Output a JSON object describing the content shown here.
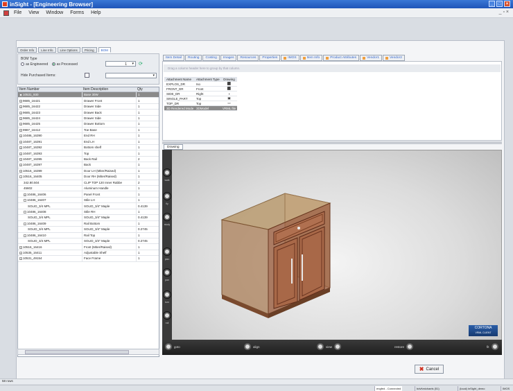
{
  "window": {
    "title": "inSight - [Engineering Browser]"
  },
  "menu": [
    "File",
    "View",
    "Window",
    "Forms",
    "Help"
  ],
  "orderTabs": [
    "Order Info",
    "Line Info",
    "Line Options",
    "Pricing",
    "BOM"
  ],
  "bom": {
    "type_label": "BOM Type",
    "opt_engineered": "as Engineered",
    "opt_processed": "as Processed",
    "hide_purchased_label": "Hide Purchased Items:",
    "qty_value": "1"
  },
  "grid": {
    "headers": [
      "Item Number",
      "Item Description",
      "Qty"
    ],
    "rows": [
      {
        "n": "10531_930",
        "d": "Base 30W",
        "q": "1",
        "sel": true,
        "exp": "-"
      },
      {
        "n": "9685_16421",
        "d": "Drawer Front",
        "q": "1",
        "exp": "+"
      },
      {
        "n": "9685_16422",
        "d": "Drawer Side",
        "q": "1",
        "exp": "+"
      },
      {
        "n": "9685_16423",
        "d": "Drawer Back",
        "q": "1",
        "exp": "+"
      },
      {
        "n": "9685_16424",
        "d": "Drawer Side",
        "q": "1",
        "exp": "+"
      },
      {
        "n": "9685_16425",
        "d": "Drawer Bottom",
        "q": "1",
        "exp": "+"
      },
      {
        "n": "9987_16412",
        "d": "Toe Base",
        "q": "1",
        "exp": "+"
      },
      {
        "n": "10486_16390",
        "d": "End RH",
        "q": "1",
        "exp": "+"
      },
      {
        "n": "10487_16391",
        "d": "End LH",
        "q": "1",
        "exp": "+"
      },
      {
        "n": "10487_16392",
        "d": "Bottom shelf",
        "q": "1",
        "exp": "+"
      },
      {
        "n": "10487_16393",
        "d": "Top",
        "q": "1",
        "exp": "+"
      },
      {
        "n": "10487_16395",
        "d": "Back Rail",
        "q": "2",
        "exp": "+"
      },
      {
        "n": "10487_16397",
        "d": "Back",
        "q": "1",
        "exp": "+"
      },
      {
        "n": "10516_16399",
        "d": "Door LH (Miter/Raised)",
        "q": "1",
        "exp": "+"
      },
      {
        "n": "10516_16405",
        "d": "Door RH (Miter/Raised)",
        "q": "1",
        "exp": "-"
      },
      {
        "n": "342.80.504",
        "d": "CLIP TOP 120 Inner Rabbe",
        "q": "2",
        "ind": 1
      },
      {
        "n": "45602",
        "d": "Aluminum Handle",
        "q": "1",
        "ind": 1
      },
      {
        "n": "10486_16406",
        "d": "Panel Front",
        "q": "1",
        "exp": "+",
        "ind": 1
      },
      {
        "n": "10486_16407",
        "d": "Stile LH",
        "q": "1",
        "exp": "-",
        "ind": 1
      },
      {
        "n": "SOLID_3/4 MPL",
        "d": "SOLID_3/4\" Maple",
        "q": "0.4139",
        "ind": 2
      },
      {
        "n": "10486_16408",
        "d": "Stile RH",
        "q": "1",
        "exp": "-",
        "ind": 1
      },
      {
        "n": "SOLID_3/4 MPL",
        "d": "SOLID_3/4\" Maple",
        "q": "0.4139",
        "ind": 2
      },
      {
        "n": "10486_16409",
        "d": "Rail Bottom",
        "q": "1",
        "exp": "-",
        "ind": 1
      },
      {
        "n": "SOLID_3/4 MPL",
        "d": "SOLID_3/4\" Maple",
        "q": "0.2745",
        "ind": 2
      },
      {
        "n": "10486_16410",
        "d": "Rail Top",
        "q": "1",
        "exp": "-",
        "ind": 1
      },
      {
        "n": "SOLID_3/4 MPL",
        "d": "SOLID_3/4\" Maple",
        "q": "0.2745",
        "ind": 2
      },
      {
        "n": "10516_16416",
        "d": "Front (Miter/Raised)",
        "q": "1",
        "exp": "+"
      },
      {
        "n": "10535_16411",
        "d": "Adjustable Shelf",
        "q": "1",
        "exp": "+"
      },
      {
        "n": "10531_49154",
        "d": "Face Frame",
        "q": "1",
        "exp": "+"
      }
    ]
  },
  "rightTabs": [
    "Item Detail",
    "Routing",
    "Costing",
    "Images",
    "Resources",
    "Properties",
    "IMOS",
    "Item Info",
    "Product Attributes",
    "Vendor1",
    "Vendor2"
  ],
  "groupbar": "Drag a column header here to group by that column.",
  "attachments": {
    "headers": [
      "Attachment Name",
      "Attachment Type",
      "Drawing"
    ],
    "rows": [
      {
        "name": "EXPLOS_DR",
        "type": "Iso"
      },
      {
        "name": "FRONT_DR",
        "type": "Front"
      },
      {
        "name": "SIDE_DR",
        "type": "Right"
      },
      {
        "name": "SINGLE_PART",
        "type": "Top"
      },
      {
        "name": "TOP_DR",
        "type": "Top"
      },
      {
        "name": "3D Rendered Mode",
        "type": "3DModel",
        "draw": "VRML file",
        "sel": true
      }
    ]
  },
  "drawingTab": "Drawing",
  "viewer": {
    "side": [
      "walk",
      "fly",
      "study",
      "plan",
      "pan",
      "turn",
      "roll"
    ],
    "bottom": {
      "goto": "goto",
      "align": "align",
      "view": "view",
      "restore": "restore",
      "fit": "fit"
    },
    "brand_top": "CORTONA",
    "brand_sub": "VRML CLIENT"
  },
  "cancel": "Cancel",
  "status": {
    "rows": "58 rows",
    "mode": "engfed - Connected",
    "user": "bdvt\\michaels (51)",
    "server": "(local) inSight_demo",
    "ims": "IMOS"
  }
}
